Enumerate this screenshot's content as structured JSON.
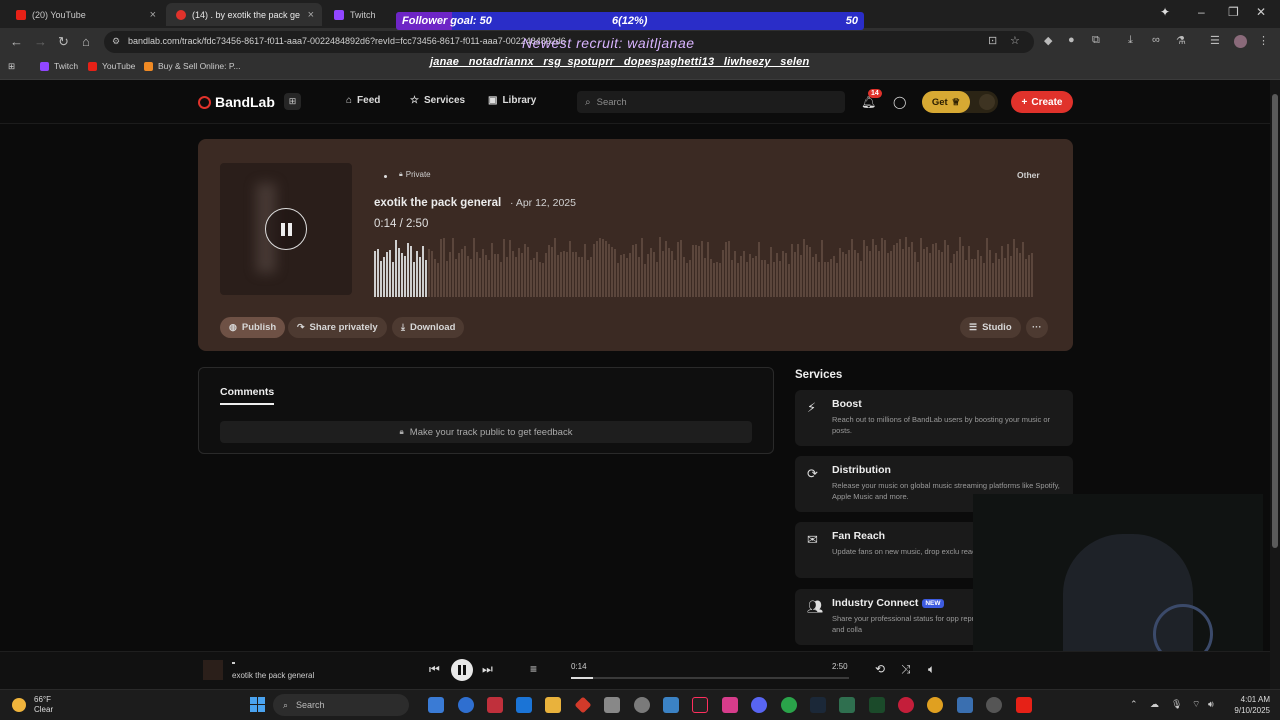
{
  "browser": {
    "tabs": [
      {
        "title": "(20) YouTube",
        "fav_color": "#e62117",
        "active": false
      },
      {
        "title": "(14) . by exotik the pack ge",
        "fav_color": "#e0322b",
        "active": true
      },
      {
        "title": "Twitch",
        "fav_color": "#9146ff",
        "active": false
      }
    ],
    "url": "bandlab.com/track/fdc73456-8617-f011-aaa7-0022484892d6?revId=fcc73456-8617-f011-aaa7-0022484892d6",
    "bookmarks": [
      {
        "label": "Twitch",
        "color": "#9146ff"
      },
      {
        "label": "YouTube",
        "color": "#e62117"
      },
      {
        "label": "Buy & Sell Online: P...",
        "color": "#f08a24"
      }
    ]
  },
  "overlay": {
    "follower_goal_label": "Follower goal: 50",
    "follower_progress_text": "6(12%)",
    "follower_progress": 0.12,
    "follower_target": "50",
    "newest_recruit": "Newest recruit: waitljanae",
    "ticker": "janae_ notadriannx_ rsg_spotuprr_ dopespaghetti13_ liwheezy_ selen"
  },
  "header": {
    "brand": "BandLab",
    "nav": [
      {
        "label": "Feed",
        "icon": "home-icon"
      },
      {
        "label": "Services",
        "icon": "star-icon"
      },
      {
        "label": "Library",
        "icon": "library-icon"
      }
    ],
    "search_placeholder": "Search",
    "notification_count": "14",
    "get_label": "Get",
    "create_label": "Create",
    "accent": "#e0322b",
    "gold": "#d7a933"
  },
  "track": {
    "privacy": "Private",
    "category": "Other",
    "title": "exotik the pack general",
    "date": "· Apr 12, 2025",
    "time": "0:14 / 2:50",
    "progress": 0.08,
    "actions": {
      "publish": "Publish",
      "share": "Share privately",
      "download": "Download",
      "studio": "Studio",
      "more": "···"
    }
  },
  "comments": {
    "tab": "Comments",
    "notice": "Make your track public to get feedback"
  },
  "services": {
    "heading": "Services",
    "items": [
      {
        "title": "Boost",
        "desc": "Reach out to millions of BandLab users by boosting your music or posts.",
        "icon": "bolt-icon",
        "badge": ""
      },
      {
        "title": "Distribution",
        "desc": "Release your music on global music streaming platforms like Spotify, Apple Music and more.",
        "icon": "distribution-icon",
        "badge": ""
      },
      {
        "title": "Fan Reach",
        "desc": "Update fans on new music, drop exclu reach out to connect.",
        "icon": "mail-icon",
        "badge": ""
      },
      {
        "title": "Industry Connect",
        "desc": "Share your professional status for opp representation, record deals and colla",
        "icon": "people-icon",
        "badge": "NEW"
      }
    ]
  },
  "player": {
    "title": "exotik the pack general",
    "current": "0:14",
    "duration": "2:50",
    "progress": 0.08
  },
  "taskbar": {
    "temp": "66°F",
    "condition": "Clear",
    "search": "Search",
    "time": "4:01 AM",
    "date": "9/10/2025"
  }
}
